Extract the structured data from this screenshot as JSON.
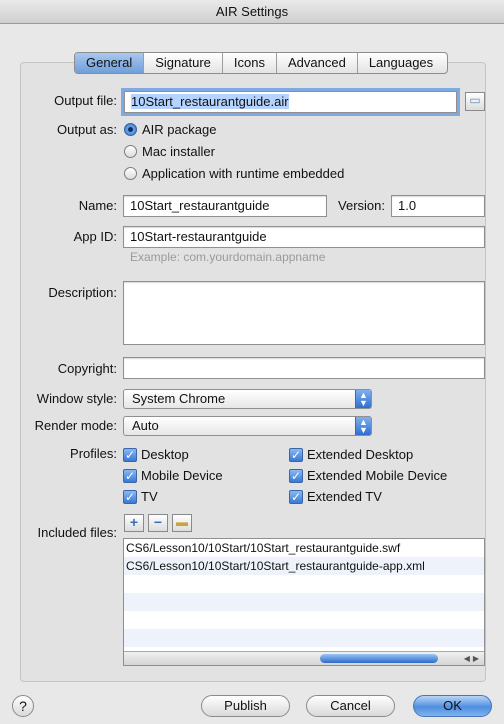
{
  "window": {
    "title": "AIR Settings"
  },
  "tabs": [
    {
      "label": "General"
    },
    {
      "label": "Signature"
    },
    {
      "label": "Icons"
    },
    {
      "label": "Advanced"
    },
    {
      "label": "Languages"
    }
  ],
  "labels": {
    "output_file": "Output file:",
    "output_as": "Output as:",
    "name": "Name:",
    "version": "Version:",
    "app_id": "App ID:",
    "description": "Description:",
    "copyright": "Copyright:",
    "window_style": "Window style:",
    "render_mode": "Render mode:",
    "profiles": "Profiles:",
    "included_files": "Included files:"
  },
  "output_file": {
    "value": "10Start_restaurantguide.air"
  },
  "output_as": {
    "options": [
      {
        "label": "AIR package",
        "selected": true
      },
      {
        "label": "Mac installer",
        "selected": false
      },
      {
        "label": "Application with runtime embedded",
        "selected": false
      }
    ]
  },
  "name": {
    "value": "10Start_restaurantguide"
  },
  "version": {
    "value": "1.0"
  },
  "app_id": {
    "value": "10Start-restaurantguide",
    "hint": "Example: com.yourdomain.appname"
  },
  "description": {
    "value": ""
  },
  "copyright": {
    "value": ""
  },
  "window_style": {
    "value": "System Chrome"
  },
  "render_mode": {
    "value": "Auto"
  },
  "profiles": [
    {
      "label": "Desktop",
      "checked": true
    },
    {
      "label": "Extended Desktop",
      "checked": true
    },
    {
      "label": "Mobile Device",
      "checked": true
    },
    {
      "label": "Extended Mobile Device",
      "checked": true
    },
    {
      "label": "TV",
      "checked": true
    },
    {
      "label": "Extended TV",
      "checked": true
    }
  ],
  "included_files": [
    "CS6/Lesson10/10Start/10Start_restaurantguide.swf",
    "CS6/Lesson10/10Start/10Start_restaurantguide-app.xml"
  ],
  "buttons": {
    "help": "?",
    "publish": "Publish",
    "cancel": "Cancel",
    "ok": "OK"
  },
  "colors": {
    "accent": "#3779d6",
    "tab_active": "#8fb6e8"
  }
}
